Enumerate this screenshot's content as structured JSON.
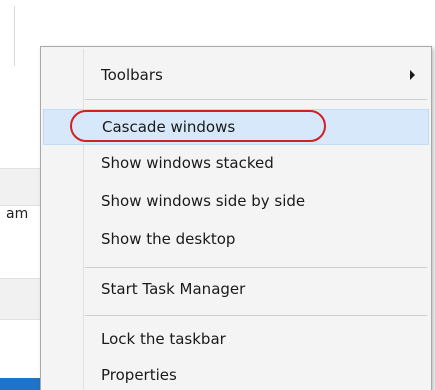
{
  "background_window": {
    "partial_text": "am",
    "accent_color": "#1f73c8"
  },
  "context_menu": {
    "items": [
      {
        "label": "Toolbars",
        "has_submenu": true,
        "icon": "chevron-right-icon"
      },
      {
        "label": "Cascade windows",
        "highlighted": true
      },
      {
        "label": "Show windows stacked"
      },
      {
        "label": "Show windows side by side"
      },
      {
        "label": "Show the desktop"
      },
      {
        "label": "Start Task Manager"
      },
      {
        "label": "Lock the taskbar"
      },
      {
        "label": "Properties"
      }
    ],
    "highlight_color": "#d6e8f9"
  },
  "annotation": {
    "color": "#d31f1f",
    "target": "Cascade windows"
  }
}
